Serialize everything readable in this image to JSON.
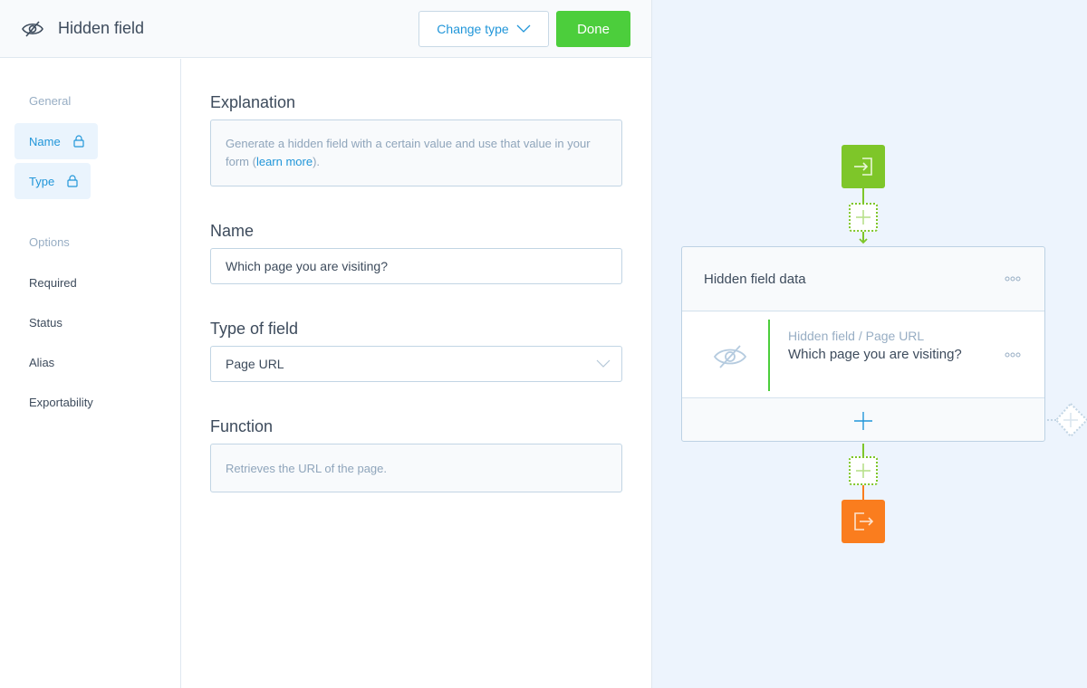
{
  "header": {
    "icon": "eye-slash-icon",
    "title": "Hidden field",
    "change_type_label": "Change type",
    "done_label": "Done"
  },
  "sidebar": {
    "general_label": "General",
    "general_items": [
      {
        "label": "Name",
        "icon": "lock-icon",
        "active": true
      },
      {
        "label": "Type",
        "icon": "lock-icon",
        "active": true
      }
    ],
    "options_label": "Options",
    "option_items": [
      {
        "label": "Required"
      },
      {
        "label": "Status"
      },
      {
        "label": "Alias"
      },
      {
        "label": "Exportability"
      }
    ]
  },
  "form": {
    "explanation_label": "Explanation",
    "explanation_text": "Generate a hidden field with a certain value and use that value in your form (",
    "explanation_link": "learn more",
    "explanation_suffix": ").",
    "name_label": "Name",
    "name_value": "Which page you are visiting?",
    "type_label": "Type of field",
    "type_value": "Page URL",
    "function_label": "Function",
    "function_text": "Retrieves the URL of the page."
  },
  "canvas": {
    "start_icon": "sign-in-icon",
    "end_icon": "sign-out-icon",
    "colors": {
      "start": "#7ec629",
      "end": "#fa7d1e",
      "accent": "#2196d9",
      "done": "#4cce3c"
    },
    "block": {
      "title": "Hidden field data",
      "field": {
        "subtitle": "Hidden field / Page URL",
        "name": "Which page you are visiting?"
      }
    }
  }
}
